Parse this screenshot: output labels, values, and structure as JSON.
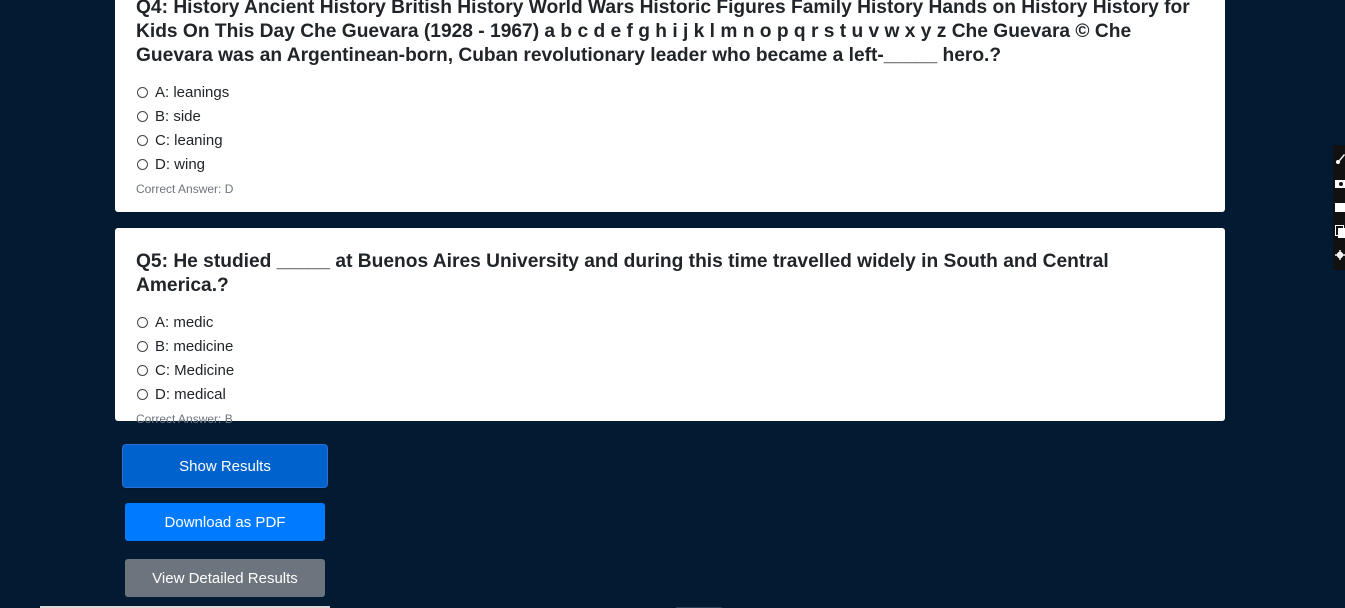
{
  "questions": [
    {
      "text": "Q4: History Ancient History British History World Wars Historic Figures Family History Hands on History History for Kids On This Day Che Guevara (1928 - 1967) a b c d e f g h i j k l m n o p q r s t u v w x y z Che Guevara   © Che Guevara was an Argentinean-born, Cuban revolutionary leader who became a left-_____ hero.?",
      "options": [
        "A: leanings",
        "B: side",
        "C: leaning",
        "D: wing"
      ],
      "correct": "Correct Answer: D"
    },
    {
      "text": "Q5: He studied _____ at Buenos Aires University and during this time travelled widely in South and Central America.?",
      "options": [
        "A: medic",
        "B: medicine",
        "C: Medicine",
        "D: medical"
      ],
      "correct": "Correct Answer: B"
    }
  ],
  "buttons": {
    "show_results": "Show Results",
    "download_pdf": "Download as PDF",
    "view_details": "View Detailed Results"
  },
  "side_toolbar": {
    "icons": [
      "brush-icon",
      "camera-icon",
      "square-icon",
      "copy-icon",
      "gear-icon"
    ]
  },
  "colors": {
    "background": "#031a33",
    "primary": "#007bff",
    "primary_active": "#0062cc",
    "secondary": "#6c757d"
  }
}
